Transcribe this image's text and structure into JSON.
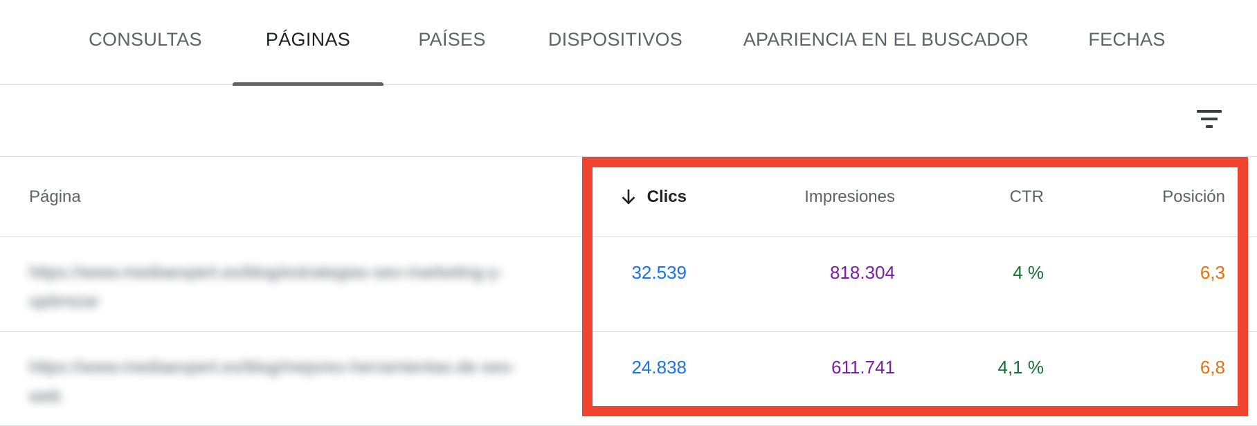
{
  "tabs": [
    {
      "label": "CONSULTAS"
    },
    {
      "label": "PÁGINAS"
    },
    {
      "label": "PAÍSES"
    },
    {
      "label": "DISPOSITIVOS"
    },
    {
      "label": "APARIENCIA EN EL BUSCADOR"
    },
    {
      "label": "FECHAS"
    }
  ],
  "active_tab": "PÁGINAS",
  "filter_icon": "filter-list-icon",
  "table": {
    "sort_icon": "arrow-down-icon",
    "headers": {
      "page": "Página",
      "clicks": "Clics",
      "impressions": "Impresiones",
      "ctr": "CTR",
      "position": "Posición"
    },
    "rows": [
      {
        "url": "https://www.mediaexpert.es/blog/estrategias-seo-marketing-y-optimizar",
        "clicks": "32.539",
        "impressions": "818.304",
        "ctr": "4 %",
        "position": "6,3"
      },
      {
        "url": "https://www.mediaexpert.es/blog/mejores-herramientas-de-seo-web",
        "clicks": "24.838",
        "impressions": "611.741",
        "ctr": "4,1 %",
        "position": "6,8"
      }
    ]
  },
  "colors": {
    "clicks": "#1a73e8",
    "impressions": "#7b1fa2",
    "ctr": "#137333",
    "position": "#e8710a",
    "highlight": "#ef4530"
  }
}
